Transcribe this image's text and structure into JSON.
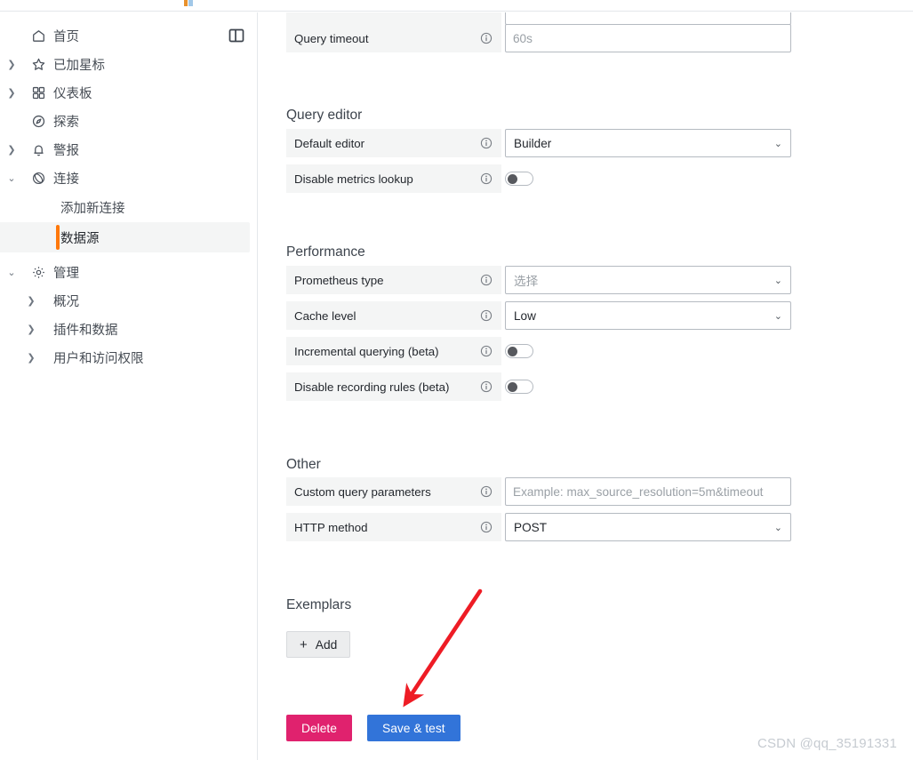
{
  "sidebar": {
    "panel_toggle_icon": "panel-toggle-icon",
    "items": [
      {
        "label": "首页",
        "icon": "home-icon",
        "chevron": "none",
        "active": false
      },
      {
        "label": "已加星标",
        "icon": "star-icon",
        "chevron": "right",
        "active": false
      },
      {
        "label": "仪表板",
        "icon": "dashboards-grid-icon",
        "chevron": "right",
        "active": false
      },
      {
        "label": "探索",
        "icon": "compass-icon",
        "chevron": "none",
        "active": false
      },
      {
        "label": "警报",
        "icon": "bell-icon",
        "chevron": "right",
        "active": false
      },
      {
        "label": "连接",
        "icon": "connections-icon",
        "chevron": "down",
        "active": false
      }
    ],
    "connections_children": [
      {
        "label": "添加新连接",
        "active": false
      },
      {
        "label": "数据源",
        "active": true
      }
    ],
    "admin": {
      "label": "管理",
      "icon": "gear-icon",
      "chevron": "down"
    },
    "admin_children": [
      {
        "label": "概况",
        "chevron": "right"
      },
      {
        "label": "插件和数据",
        "chevron": "right"
      },
      {
        "label": "用户和访问权限",
        "chevron": "right"
      }
    ]
  },
  "main": {
    "rows_top": [
      {
        "label": "Query timeout",
        "info_icon": "info-circle-icon",
        "control": "input",
        "value": "",
        "placeholder": "60s"
      }
    ],
    "sections": [
      {
        "title": "Query editor",
        "rows": [
          {
            "label": "Default editor",
            "info_icon": "info-circle-icon",
            "control": "select",
            "value": "Builder",
            "is_placeholder": false,
            "caret_icon": "chevron-down-icon"
          },
          {
            "label": "Disable metrics lookup",
            "info_icon": "info-circle-icon",
            "control": "toggle",
            "checked": false
          }
        ]
      },
      {
        "title": "Performance",
        "rows": [
          {
            "label": "Prometheus type",
            "info_icon": "info-circle-icon",
            "control": "select",
            "value": "选择",
            "is_placeholder": true,
            "caret_icon": "chevron-down-icon"
          },
          {
            "label": "Cache level",
            "info_icon": "info-circle-icon",
            "control": "select",
            "value": "Low",
            "is_placeholder": false,
            "caret_icon": "chevron-down-icon"
          },
          {
            "label": "Incremental querying (beta)",
            "info_icon": "info-circle-icon",
            "control": "toggle",
            "checked": false
          },
          {
            "label": "Disable recording rules (beta)",
            "info_icon": "info-circle-icon",
            "control": "toggle",
            "checked": false
          }
        ]
      },
      {
        "title": "Other",
        "rows": [
          {
            "label": "Custom query parameters",
            "info_icon": "info-circle-icon",
            "control": "input",
            "value": "",
            "placeholder": "Example: max_source_resolution=5m&timeout"
          },
          {
            "label": "HTTP method",
            "info_icon": "info-circle-icon",
            "control": "select",
            "value": "POST",
            "is_placeholder": false,
            "caret_icon": "chevron-down-icon"
          }
        ]
      },
      {
        "title": "Exemplars",
        "rows": []
      }
    ],
    "add_button": {
      "label": "Add",
      "plus_icon": "plus-icon"
    },
    "delete_button": {
      "label": "Delete"
    },
    "save_button": {
      "label": "Save & test"
    }
  },
  "annotation": {
    "arrow_icon": "red-arrow-annotation",
    "color": "#ee1c25"
  },
  "watermark": {
    "text": "CSDN @qq_35191331"
  },
  "colors": {
    "accent_orange": "#ff780a",
    "save_blue": "#3274d9",
    "delete_pink": "#e0226e",
    "label_bg": "#f4f5f5",
    "border": "#b5bac1"
  }
}
